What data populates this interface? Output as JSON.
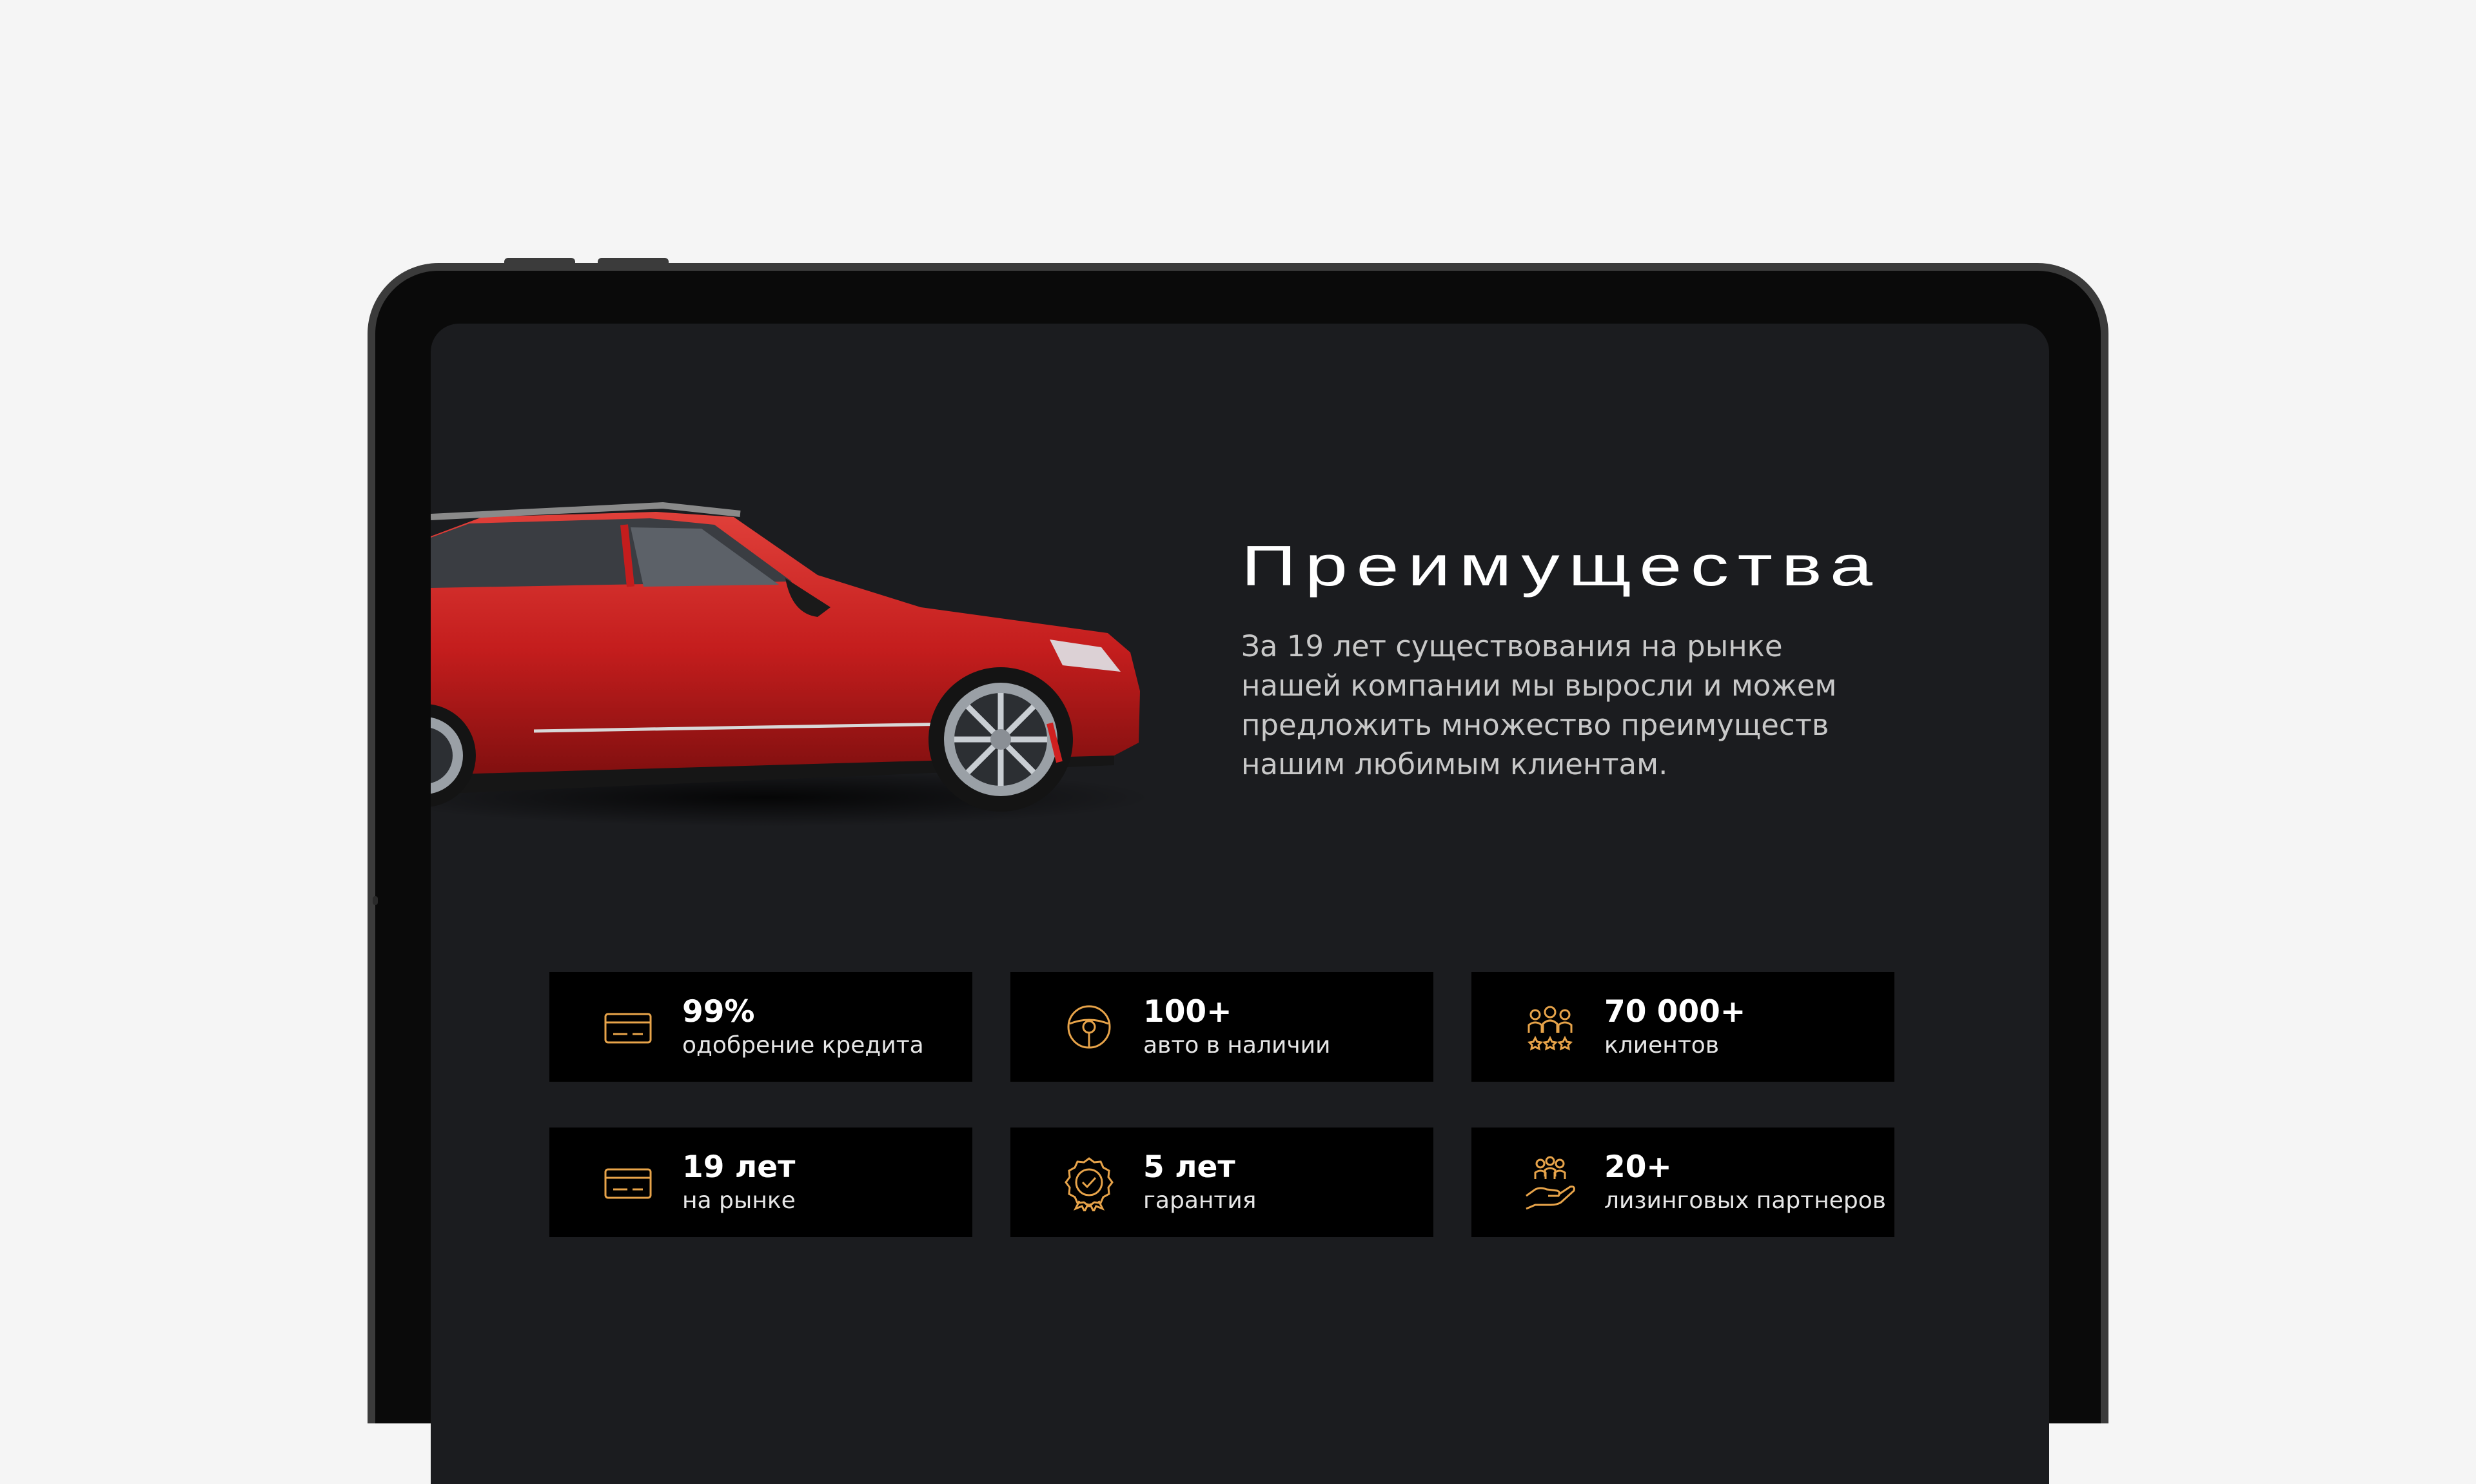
{
  "section": {
    "title": "Преимущества",
    "description": "За 19 лет существования на рынке нашей компании мы выросли и можем предложить множество преимуществ нашим любимым клиентам."
  },
  "colors": {
    "accent": "#e8a44a",
    "background": "#1b1c1f",
    "card": "#000000",
    "car": "#c41d1d"
  },
  "stats": [
    {
      "value": "99%",
      "label": "одобрение кредита",
      "icon": "credit-card-icon"
    },
    {
      "value": "100+",
      "label": "авто в наличии",
      "icon": "steering-wheel-icon"
    },
    {
      "value": "70 000+",
      "label": "клиентов",
      "icon": "clients-rating-icon"
    },
    {
      "value": "19 лет",
      "label": "на рынке",
      "icon": "credit-card-icon"
    },
    {
      "value": "5 лет",
      "label": "гарантия",
      "icon": "warranty-badge-icon"
    },
    {
      "value": "20+",
      "label": "лизинговых партнеров",
      "icon": "partners-hand-icon"
    }
  ]
}
